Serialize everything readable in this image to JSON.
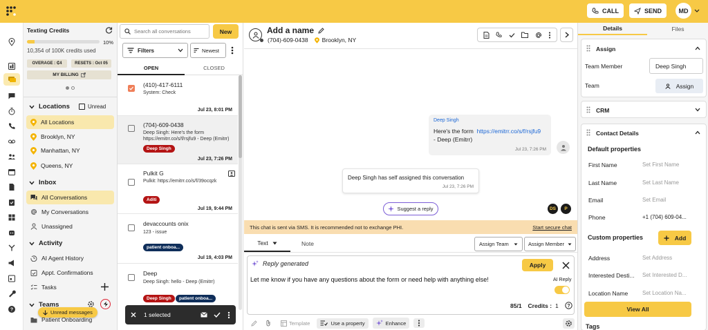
{
  "header": {
    "call_label": "CALL",
    "send_label": "SEND",
    "avatar_initials": "MD"
  },
  "credits": {
    "title": "Texting Credits",
    "percent": "10%",
    "fill_fraction": 0.1,
    "used": "10,354 of 100K credits used",
    "overage": "OVERAGE : ₵4",
    "resets": "RESETS : Oct 05",
    "billing": "MY BILLING"
  },
  "locations": {
    "title": "Locations",
    "unread": "Unread",
    "items": [
      {
        "label": "All Locations"
      },
      {
        "label": "Brooklyn, NY"
      },
      {
        "label": "Manhattan, NY"
      },
      {
        "label": "Queens, NY"
      }
    ]
  },
  "inbox": {
    "title": "Inbox",
    "items": [
      {
        "label": "All Conversations"
      },
      {
        "label": "My Conversations"
      },
      {
        "label": "Unassigned"
      }
    ]
  },
  "activity": {
    "title": "Activity",
    "items": [
      {
        "label": "AI Agent History"
      },
      {
        "label": "Appt. Confirmations"
      },
      {
        "label": "Tasks"
      }
    ]
  },
  "teams": {
    "title": "Teams",
    "items": [
      {
        "label": "Patient Onboarding"
      }
    ]
  },
  "unread_pill": "Unread messages",
  "list": {
    "search_placeholder": "Search all conversations",
    "new_label": "New",
    "filters_label": "Filters",
    "sort_label": "Newest",
    "tab_open": "OPEN",
    "tab_closed": "CLOSED",
    "conversations": [
      {
        "name": "(410)-417-6111",
        "preview": "System: Check",
        "time": "Jul 23, 8:01 PM",
        "tags": []
      },
      {
        "name": "(704)-609-0438",
        "preview": "Deep Singh: Here's the form https://emitrr.co/s/f/rsjfu9 - Deep (Emitrr)",
        "time": "Jul 23, 7:26 PM",
        "tags": [
          "Deep Singh"
        ]
      },
      {
        "name": "Pulkit G",
        "preview": "Pulkit: https://emitrr.co/s/f/39ocqzk",
        "time": "Jul 19, 9:44 PM",
        "tags": [
          "Aditi"
        ]
      },
      {
        "name": "devaccounts onix",
        "preview": "123 - issue",
        "time": "Jul 19, 4:03 PM",
        "tags": [
          "patient onboa..."
        ]
      },
      {
        "name": "Deep",
        "preview": "Deep Singh: hello - Deep (Emitrr)",
        "time": "",
        "tags": [
          "Deep Singh",
          "patient onboa..."
        ]
      }
    ],
    "selected_bar": "1 selected"
  },
  "contact": {
    "name": "Add a name",
    "phone": "(704)-609-0438",
    "location": "Brooklyn, NY"
  },
  "thread": {
    "sender": "Deep Singh",
    "msg_text": "Here's the form",
    "msg_link": "https://emitrr.co/s/f/rsjfu9",
    "msg_sign": "- Deep (Emitrr)",
    "msg_time": "Jul 23, 7:26 PM",
    "system_text": "Deep Singh has self assigned this conversation",
    "system_time": "Jul 23, 7:26 PM",
    "suggest": "Suggest a reply",
    "av1": "DS",
    "av2": "P"
  },
  "phi": {
    "text": "This chat is sent via SMS. It is recommended not to exchange PHI.",
    "link": "Start secure chat"
  },
  "composer": {
    "tab_text": "Text",
    "tab_note": "Note",
    "assign_team": "Assign Team",
    "assign_member": "Assign Member",
    "reply_generated": "Reply generated",
    "apply": "Apply",
    "body": "Let me know if you have any questions about the form or need help with anything else!",
    "ai_reply": "AI Reply",
    "counter": "85/1",
    "credits_label": "Credits :",
    "credits_val": "1",
    "template": "Template",
    "use_property": "Use a property",
    "enhance": "Enhance"
  },
  "right": {
    "tab_details": "Details",
    "tab_files": "Files",
    "assign_title": "Assign",
    "team_member_label": "Team Member",
    "team_member_value": "Deep Singh",
    "team_label": "Team",
    "assign_btn": "Assign",
    "crm_title": "CRM",
    "contact_title": "Contact Details",
    "default_props": "Default properties",
    "fields": [
      {
        "label": "First Name",
        "value": "Set First Name"
      },
      {
        "label": "Last Name",
        "value": "Set Last Name"
      },
      {
        "label": "Email",
        "value": "Set Email"
      },
      {
        "label": "Phone",
        "value": "+1 (704) 609-04..."
      }
    ],
    "custom_props": "Custom properties",
    "add": "Add",
    "custom_fields": [
      {
        "label": "Address",
        "value": "Set Address"
      },
      {
        "label": "Interested Desti...",
        "value": "Set Interested D..."
      },
      {
        "label": "Location Name",
        "value": "Set Location Na..."
      }
    ],
    "view_all": "View All",
    "tags_title": "Tags"
  },
  "colors": {
    "accent": "#f7c945",
    "tag_red": "#b41414",
    "tag_navy": "#0f2e5a",
    "link": "#1a66d6",
    "suggest": "#7a5cd6"
  }
}
